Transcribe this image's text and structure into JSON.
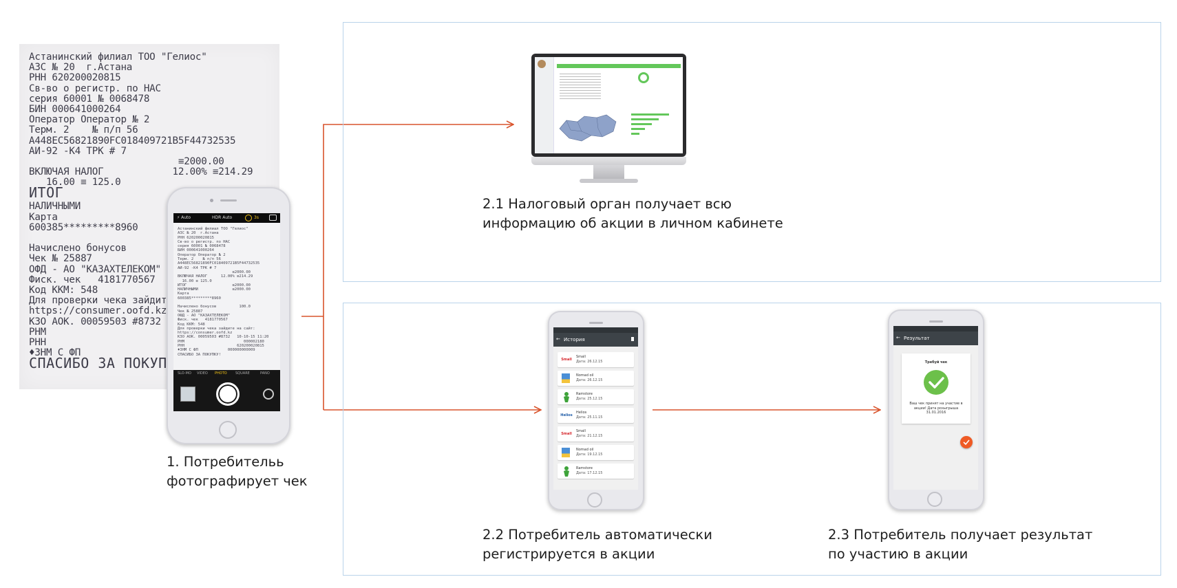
{
  "receipt": {
    "lines": [
      "Астанинский филиал ТОО \"Гелиос\"",
      "АЗС № 20  г.Астана",
      "РНН 620200020815",
      "Св-во о регистр. по НАС",
      "серия 60001 № 0068478",
      "БИН 000641000264",
      "Оператор Оператор № 2",
      "Терм. 2    № п/п 56",
      "A448EC56821890FC018409721B5F44732535",
      "АИ-92 -К4 ТРК # 7",
      "                          ≡2000.00",
      "ВКЛЮЧАЯ НАЛОГ            12.00% ≡214.29",
      "   16.00 ≡ 125.0",
      "ИТОГ",
      "НАЛИЧНЫМИ",
      "Карта",
      "600385*********8960",
      "",
      "Начислено бонусов",
      "Чек № 25887",
      "ОФД - АО \"КАЗАХТЕЛЕКОМ\"",
      "Фиск. чек   4181770567",
      "Код ККМ: 548",
      "Для проверки чека зайдите на сайт:",
      "https://consumer.oofd.kz",
      "КЗО АОК. 00059503 #8732",
      "РНМ",
      "РНН",
      "♦ЗНМ С ФП",
      "СПАСИБО ЗА ПОКУПКУ!"
    ]
  },
  "camera_phone": {
    "top_left": "⚡ Auto",
    "top_mid": "HDR Auto",
    "top_timer": "3s",
    "modes": [
      "SLO-MO",
      "VIDEO",
      "PHOTO",
      "SQUARE",
      "PANO"
    ],
    "active_mode": "PHOTO",
    "screen_lines": [
      "Астанинский филиал ТОО \"Гелиос\"",
      "АЗС № 20  г.Астана",
      "РНН 620200020815",
      "Св-во о регистр. по НАС",
      "серия 60001 № 0068478",
      "БИН 000641000264",
      "Оператор Оператор № 2",
      "Терм. 2    № п/п 56",
      "A448EC56821890FC018409721B5F44732535",
      "АИ-92 -К4 ТРК # 7",
      "                        ≡2000.00",
      "ВКЛЮЧАЯ НАЛОГ      12.00% ≡214.29",
      "  16.00 ≡ 125.0",
      "ИТОГ                    ≡2000.00",
      "НАЛИЧНЫМИ               ≡2000.00",
      "Карта",
      "600385*********8960",
      "",
      "Начислено бонусов          100.0",
      "Чек № 25887",
      "ОФД - АО \"КАЗАХТЕЛЕКОМ\"",
      "Фиск. чек   4181770567",
      "Код ККМ: 548",
      "Для проверки чека зайдите на сайт:",
      "https://consumer.oofd.kz",
      "КЗО АОК. 00059503 #8732   10-10-15 11:20",
      "РНМ                          000002180",
      "РНН                       620200020815",
      "♦ЗНМ С ФП             000000000009",
      "СПАСИБО ЗА ПОКУПКУ!"
    ]
  },
  "history_phone": {
    "title": "История",
    "items": [
      {
        "brand": "Small",
        "logo": "Small",
        "date": "Дата: 26.12.15"
      },
      {
        "brand": "Nomad oil",
        "logo": "",
        "date": "Дата: 26.12.15"
      },
      {
        "brand": "Ramstore",
        "logo": "",
        "date": "Дата: 25.12.15"
      },
      {
        "brand": "Helios",
        "logo": "Helios",
        "date": "Дата: 25.11.15"
      },
      {
        "brand": "Small",
        "logo": "Small",
        "date": "Дата: 21.12.15"
      },
      {
        "brand": "Nomad oil",
        "logo": "",
        "date": "Дата: 19.12.15"
      },
      {
        "brand": "Ramstore",
        "logo": "",
        "date": "Дата: 17.12.15"
      }
    ]
  },
  "result_phone": {
    "title": "Результат",
    "card_title": "Требуй чек",
    "message": "Ваш чек принят на участие в акции! Дата розыгрыша 31.01.2016"
  },
  "captions": {
    "step1_line1": "1. Потребительь",
    "step1_line2": "фотографирует чек",
    "step21_line1": "2.1 Налоговый орган получает всю",
    "step21_line2": "информацию об акции в личном кабинете",
    "step22_line1": "2.2 Потребитель автоматически",
    "step22_line2": "регистрируется в акции",
    "step23_line1": "2.3 Потребитель получает результат",
    "step23_line2": "по участию в акции"
  },
  "colors": {
    "arrow": "#d9532b",
    "frame": "#b9d3ea",
    "check_green": "#6cc04a",
    "fab_orange": "#ef5a24",
    "dashboard_green": "#63c75a"
  }
}
